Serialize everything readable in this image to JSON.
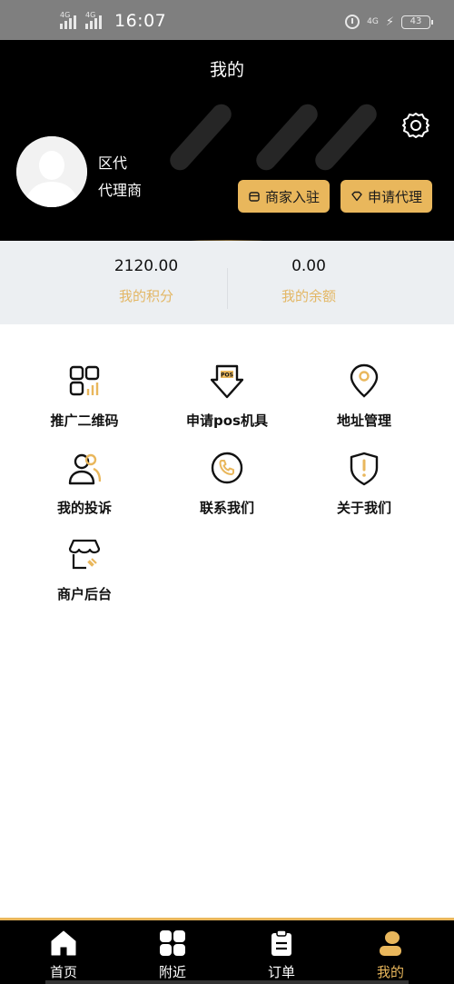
{
  "status_bar": {
    "network_left": "4G",
    "time": "16:07",
    "network_right": "4G",
    "battery": "43"
  },
  "header": {
    "title": "我的",
    "user_name": "区代",
    "user_role": "代理商",
    "merchant_button": "商家入驻",
    "agent_button": "申请代理"
  },
  "stats": {
    "points_value": "2120.00",
    "points_label": "我的积分",
    "balance_value": "0.00",
    "balance_label": "我的余额"
  },
  "menu": {
    "items": [
      {
        "label": "推广二维码",
        "icon": "qrcode-icon"
      },
      {
        "label": "申请pos机具",
        "icon": "pos-machine-icon"
      },
      {
        "label": "地址管理",
        "icon": "location-pin-icon"
      },
      {
        "label": "我的投诉",
        "icon": "users-complaint-icon"
      },
      {
        "label": "联系我们",
        "icon": "phone-icon"
      },
      {
        "label": "关于我们",
        "icon": "shield-info-icon"
      },
      {
        "label": "商户后台",
        "icon": "shop-icon"
      }
    ]
  },
  "tabbar": {
    "items": [
      {
        "label": "首页",
        "icon": "home-icon"
      },
      {
        "label": "附近",
        "icon": "grid-icon"
      },
      {
        "label": "订单",
        "icon": "clipboard-icon"
      },
      {
        "label": "我的",
        "icon": "profile-icon"
      }
    ],
    "active_index": 3
  },
  "colors": {
    "accent": "#e9b75c",
    "header_bg": "#000000",
    "stats_bg": "#eceff2",
    "label_gold": "#e3b765"
  }
}
